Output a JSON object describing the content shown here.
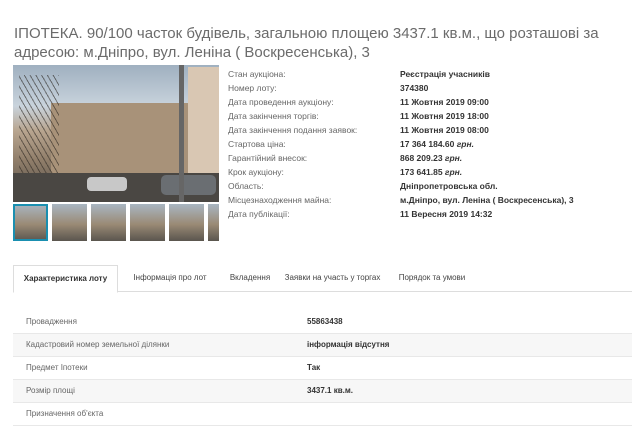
{
  "title": "ІПОТЕКА. 90/100 часток будівель, загальною площею 3437.1 кв.м., що розташові за адресою: м.Дніпро, вул. Леніна ( Воскресенська), 3",
  "details": [
    {
      "label": "Стан аукціона:",
      "value": "Реєстрація учасників"
    },
    {
      "label": "Номер лоту:",
      "value": "374380"
    },
    {
      "label": "Дата проведення аукціону:",
      "value": "11 Жовтня 2019 09:00"
    },
    {
      "label": "Дата закінчення торгів:",
      "value": "11 Жовтня 2019 18:00"
    },
    {
      "label": "Дата закінчення подання заявок:",
      "value": "11 Жовтня 2019 08:00"
    },
    {
      "label": "Стартова ціна:",
      "value": "17 364 184.60",
      "unit": "грн."
    },
    {
      "label": "Гарантійний внесок:",
      "value": "868 209.23",
      "unit": "грн."
    },
    {
      "label": "Крок аукціону:",
      "value": "173 641.85",
      "unit": "грн."
    },
    {
      "label": "Область:",
      "value": "Дніпропетровська обл."
    },
    {
      "label": "Місцезнаходження майна:",
      "value": "м.Дніпро, вул. Леніна ( Воскресенська), 3"
    },
    {
      "label": "Дата публікації:",
      "value": "11 Вересня 2019 14:32"
    }
  ],
  "tabs": [
    {
      "label": "Характеристика лоту",
      "active": true
    },
    {
      "label": "Інформація про лот"
    },
    {
      "label": "Вкладення"
    },
    {
      "label": "Заявки на участь у торгах"
    },
    {
      "label": "Порядок та умови"
    }
  ],
  "properties": [
    {
      "label": "Провадження",
      "value": "55863438"
    },
    {
      "label": "Кадастровий номер земельної ділянки",
      "value": "інформація відсутня"
    },
    {
      "label": "Предмет Іпотеки",
      "value": "Так"
    },
    {
      "label": "Розмір площі",
      "value": "3437.1 кв.м."
    },
    {
      "label": "Призначення об'єкта",
      "value": ""
    }
  ]
}
